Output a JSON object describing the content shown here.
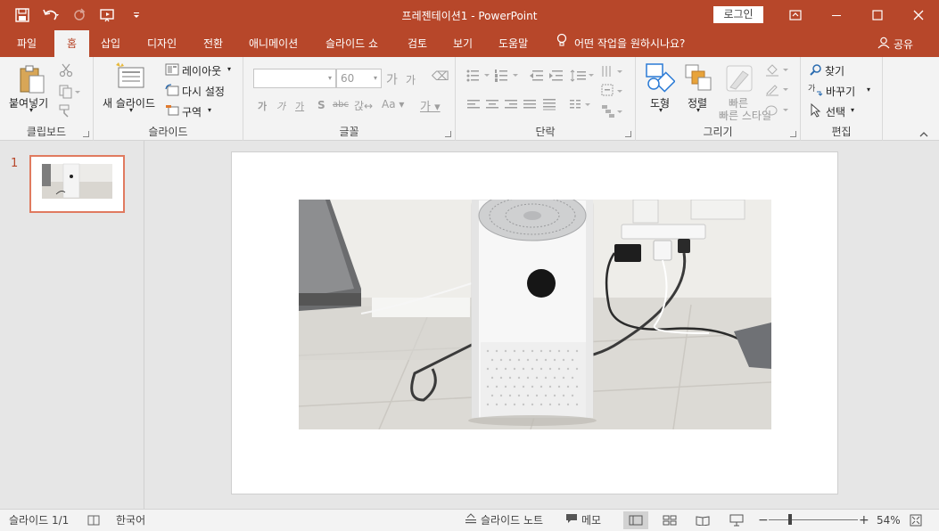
{
  "window": {
    "title": "프레젠테이션1  -  PowerPoint",
    "login_label": "로그인"
  },
  "tabs": [
    {
      "label": "파일"
    },
    {
      "label": "홈"
    },
    {
      "label": "삽입"
    },
    {
      "label": "디자인"
    },
    {
      "label": "전환"
    },
    {
      "label": "애니메이션"
    },
    {
      "label": "슬라이드 쇼"
    },
    {
      "label": "검토"
    },
    {
      "label": "보기"
    },
    {
      "label": "도움말"
    }
  ],
  "tell_me": "어떤 작업을 원하시나요?",
  "share_label": "공유",
  "ribbon": {
    "clipboard": {
      "paste": "붙여넣기",
      "group": "클립보드"
    },
    "slides": {
      "new_slide": "새 슬라이드",
      "layout": "레이아웃",
      "reset": "다시 설정",
      "section": "구역",
      "group": "슬라이드"
    },
    "font": {
      "font_size": "60",
      "group": "글꼴"
    },
    "paragraph": {
      "group": "단락"
    },
    "drawing": {
      "shapes": "도형",
      "arrange": "정렬",
      "quick_styles": "빠른 스타일",
      "group": "그리기"
    },
    "editing": {
      "find": "찾기",
      "replace": "바꾸기",
      "select": "선택",
      "group": "편집"
    }
  },
  "thumbnails": [
    {
      "number": "1"
    }
  ],
  "status": {
    "slide_counter": "슬라이드 1/1",
    "language": "한국어",
    "notes": "슬라이드 노트",
    "comments": "메모",
    "zoom": "54%"
  },
  "colors": {
    "accent": "#b7472a",
    "thumb_border": "#e07a5f"
  }
}
